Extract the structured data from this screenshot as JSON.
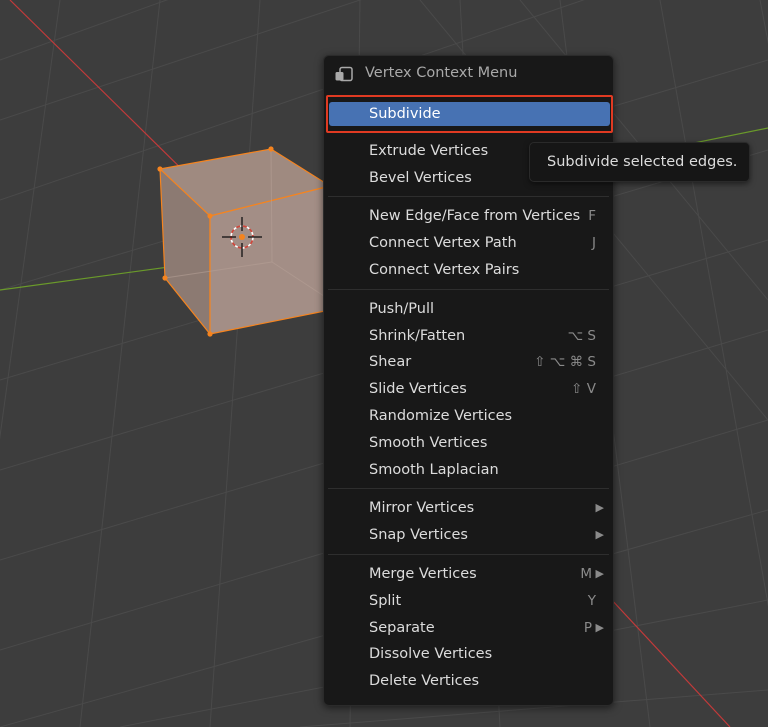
{
  "viewport": {
    "background_color": "#3d3d3d",
    "grid_color": "#4a4a4a",
    "x_axis_color": "#c23a3a",
    "y_axis_color": "#6a9a2a",
    "selection_color": "#f5841f"
  },
  "menu": {
    "title": "Vertex Context Menu",
    "title_icon": "menu-icon",
    "highlight_color": "#4772b3",
    "annotation_color": "#e03a22",
    "groups": [
      [
        {
          "label": "Subdivide",
          "shortcut": "",
          "submenu": false,
          "highlighted": true
        }
      ],
      [
        {
          "label": "Extrude Vertices",
          "shortcut": "",
          "submenu": false
        },
        {
          "label": "Bevel Vertices",
          "shortcut": "",
          "submenu": false
        }
      ],
      [
        {
          "label": "New Edge/Face from Vertices",
          "shortcut": "F",
          "submenu": false
        },
        {
          "label": "Connect Vertex Path",
          "shortcut": "J",
          "submenu": false
        },
        {
          "label": "Connect Vertex Pairs",
          "shortcut": "",
          "submenu": false
        }
      ],
      [
        {
          "label": "Push/Pull",
          "shortcut": "",
          "submenu": false
        },
        {
          "label": "Shrink/Fatten",
          "shortcut": "⌥ S",
          "submenu": false
        },
        {
          "label": "Shear",
          "shortcut": "⇧ ⌥ ⌘ S",
          "submenu": false
        },
        {
          "label": "Slide Vertices",
          "shortcut": "⇧ V",
          "submenu": false
        },
        {
          "label": "Randomize Vertices",
          "shortcut": "",
          "submenu": false
        },
        {
          "label": "Smooth Vertices",
          "shortcut": "",
          "submenu": false
        },
        {
          "label": "Smooth Laplacian",
          "shortcut": "",
          "submenu": false
        }
      ],
      [
        {
          "label": "Mirror Vertices",
          "shortcut": "",
          "submenu": true
        },
        {
          "label": "Snap Vertices",
          "shortcut": "",
          "submenu": true
        }
      ],
      [
        {
          "label": "Merge Vertices",
          "shortcut": "M",
          "submenu": true
        },
        {
          "label": "Split",
          "shortcut": "Y",
          "submenu": false
        },
        {
          "label": "Separate",
          "shortcut": "P",
          "submenu": true
        },
        {
          "label": "Dissolve Vertices",
          "shortcut": "",
          "submenu": false
        },
        {
          "label": "Delete Vertices",
          "shortcut": "",
          "submenu": false
        }
      ]
    ]
  },
  "tooltip": {
    "text": "Subdivide selected edges."
  }
}
